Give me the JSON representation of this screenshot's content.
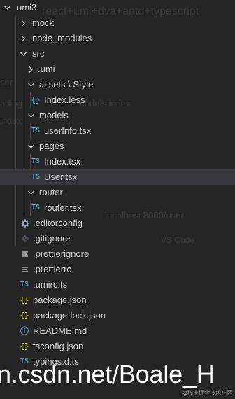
{
  "tree": {
    "root": "umi3",
    "mock": "mock",
    "node_modules": "node_modules",
    "src": "src",
    "umi": ".umi",
    "assets": "assets \\ Style",
    "index_less": "Index.less",
    "models": "models",
    "userinfo": "userInfo.tsx",
    "pages": "pages",
    "index_tsx": "Index.tsx",
    "user_tsx": "User.tsx",
    "router": "router",
    "router_tsx": "router.tsx",
    "editorconfig": ".editorconfig",
    "gitignore": ".gitignore",
    "prettierignore": ".prettierignore",
    "prettierrc": ".prettierrc",
    "umirc": ".umirc.ts",
    "package_json": "package.json",
    "package_lock": "package-lock.json",
    "readme": "README.md",
    "tsconfig": "tsconfig.json",
    "typings": "typings.d.ts"
  },
  "icons": {
    "ts": "TS",
    "json": "{}",
    "info": "ⓘ"
  },
  "watermark": {
    "big": "n.csdn.net/Boale_H",
    "small": "@稀土掘金技术社区"
  },
  "colors": {
    "background": "#252526",
    "selected_row": "#37373d",
    "text": "#cccccc",
    "ts_icon": "#519aba",
    "json_icon": "#cbcb41"
  }
}
